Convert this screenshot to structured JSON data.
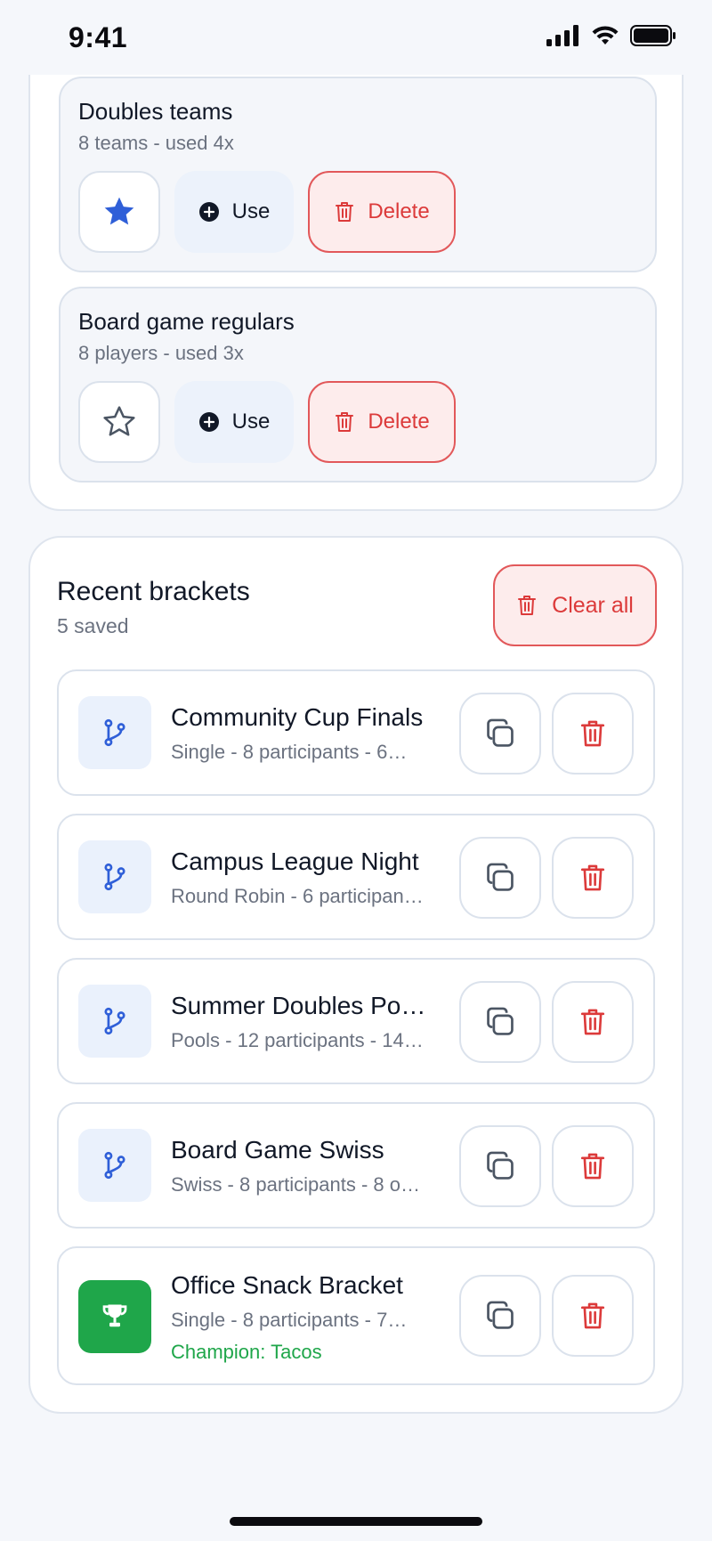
{
  "status": {
    "time": "9:41"
  },
  "templates": [
    {
      "title": "Doubles teams",
      "subtitle": "8 teams - used 4x",
      "starred": true,
      "use_label": "Use",
      "delete_label": "Delete"
    },
    {
      "title": "Board game regulars",
      "subtitle": "8 players - used 3x",
      "starred": false,
      "use_label": "Use",
      "delete_label": "Delete"
    }
  ],
  "recent": {
    "title": "Recent brackets",
    "subtitle": "5 saved",
    "clear_label": "Clear all",
    "items": [
      {
        "title": "Community Cup Finals",
        "subtitle": "Single - 8 participants - 6…",
        "icon": "bracket-icon"
      },
      {
        "title": "Campus League Night",
        "subtitle": "Round Robin - 6 participan…",
        "icon": "bracket-icon"
      },
      {
        "title": "Summer Doubles Po…",
        "subtitle": "Pools - 12 participants - 14…",
        "icon": "bracket-icon"
      },
      {
        "title": "Board Game Swiss",
        "subtitle": "Swiss - 8 participants - 8 o…",
        "icon": "bracket-icon"
      },
      {
        "title": "Office Snack Bracket",
        "subtitle": "Single - 8 participants - 7…",
        "champion": "Champion: Tacos",
        "icon": "trophy-icon"
      }
    ]
  },
  "colors": {
    "accent_blue": "#2f5fd8",
    "danger": "#dc3a3a",
    "success": "#1fa64a"
  }
}
